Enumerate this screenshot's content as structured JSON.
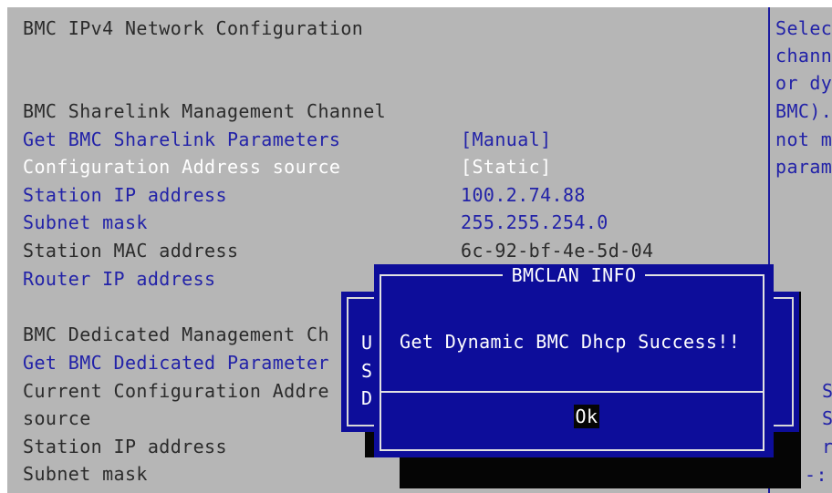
{
  "left_panel": {
    "section_title": "BMC IPv4 Network Configuration",
    "sharelink": {
      "header": "BMC Sharelink Management Channel",
      "rows": [
        {
          "label": "Get BMC Sharelink Parameters",
          "value": "[Manual]"
        },
        {
          "label": "Configuration Address source",
          "value": "[Static]"
        },
        {
          "label": "Station IP address",
          "value": "100.2.74.88"
        },
        {
          "label": "Subnet mask",
          "value": "255.255.254.0"
        },
        {
          "label": "Station MAC address",
          "value": "6c-92-bf-4e-5d-04"
        },
        {
          "label": "Router IP address",
          "value": ""
        }
      ]
    },
    "dedicated": {
      "header": "BMC Dedicated Management Ch",
      "get_params": "Get BMC Dedicated Parameter",
      "current_config_line1": "Current Configuration Addre",
      "current_config_line2": "source",
      "station_ip": "Station IP address",
      "subnet": "Subnet mask"
    }
  },
  "help_panel": {
    "lines": [
      "Selec",
      "chann",
      "or dy",
      "BMC).",
      "not m",
      "param"
    ],
    "lower_fragments": [
      "S",
      "S",
      "r",
      "-:"
    ]
  },
  "back_dialog": {
    "visible_letters": [
      "U",
      "S",
      "D"
    ]
  },
  "dialog": {
    "title": "BMCLAN INFO",
    "message": "Get Dynamic BMC Dhcp Success!!",
    "ok_label": "Ok"
  }
}
